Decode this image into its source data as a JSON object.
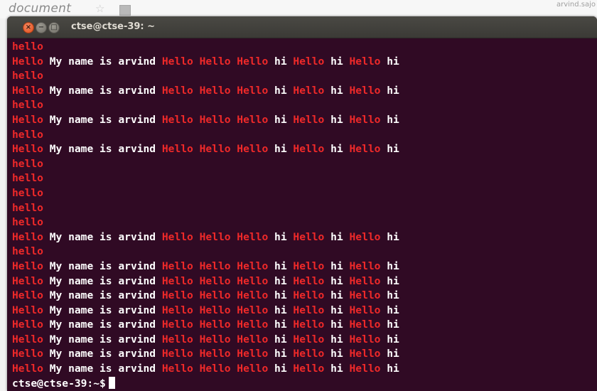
{
  "background": {
    "doc_title": "document",
    "user_text": "arvind.sajo"
  },
  "window": {
    "title": "ctse@ctse-39: ~",
    "buttons": {
      "close": "×",
      "minimize": "−",
      "maximize": "□"
    }
  },
  "colors": {
    "background": "#300a24",
    "red": "#ef2929",
    "text": "#ffffff"
  },
  "terminal": {
    "lines": [
      [
        [
          "red",
          "hello"
        ]
      ],
      [
        [
          "red",
          "Hello"
        ],
        [
          "white",
          " My name is arvind "
        ],
        [
          "red",
          "Hello Hello Hello"
        ],
        [
          "white",
          " hi "
        ],
        [
          "red",
          "Hello"
        ],
        [
          "white",
          " hi "
        ],
        [
          "red",
          "Hello"
        ],
        [
          "white",
          " hi"
        ]
      ],
      [
        [
          "red",
          "hello"
        ]
      ],
      [
        [
          "red",
          "Hello"
        ],
        [
          "white",
          " My name is arvind "
        ],
        [
          "red",
          "Hello Hello Hello"
        ],
        [
          "white",
          " hi "
        ],
        [
          "red",
          "Hello"
        ],
        [
          "white",
          " hi "
        ],
        [
          "red",
          "Hello"
        ],
        [
          "white",
          " hi"
        ]
      ],
      [
        [
          "red",
          "hello"
        ]
      ],
      [
        [
          "red",
          "Hello"
        ],
        [
          "white",
          " My name is arvind "
        ],
        [
          "red",
          "Hello Hello Hello"
        ],
        [
          "white",
          " hi "
        ],
        [
          "red",
          "Hello"
        ],
        [
          "white",
          " hi "
        ],
        [
          "red",
          "Hello"
        ],
        [
          "white",
          " hi"
        ]
      ],
      [
        [
          "red",
          "hello"
        ]
      ],
      [
        [
          "red",
          "Hello"
        ],
        [
          "white",
          " My name is arvind "
        ],
        [
          "red",
          "Hello Hello Hello"
        ],
        [
          "white",
          " hi "
        ],
        [
          "red",
          "Hello"
        ],
        [
          "white",
          " hi "
        ],
        [
          "red",
          "Hello"
        ],
        [
          "white",
          " hi"
        ]
      ],
      [
        [
          "red",
          "hello"
        ]
      ],
      [
        [
          "red",
          "hello"
        ]
      ],
      [
        [
          "red",
          "hello"
        ]
      ],
      [
        [
          "red",
          "hello"
        ]
      ],
      [
        [
          "red",
          "hello"
        ]
      ],
      [
        [
          "red",
          "Hello"
        ],
        [
          "white",
          " My name is arvind "
        ],
        [
          "red",
          "Hello Hello Hello"
        ],
        [
          "white",
          " hi "
        ],
        [
          "red",
          "Hello"
        ],
        [
          "white",
          " hi "
        ],
        [
          "red",
          "Hello"
        ],
        [
          "white",
          " hi"
        ]
      ],
      [
        [
          "red",
          "hello"
        ]
      ],
      [
        [
          "red",
          "Hello"
        ],
        [
          "white",
          " My name is arvind "
        ],
        [
          "red",
          "Hello Hello Hello"
        ],
        [
          "white",
          " hi "
        ],
        [
          "red",
          "Hello"
        ],
        [
          "white",
          " hi "
        ],
        [
          "red",
          "Hello"
        ],
        [
          "white",
          " hi"
        ]
      ],
      [
        [
          "red",
          "Hello"
        ],
        [
          "white",
          " My name is arvind "
        ],
        [
          "red",
          "Hello Hello Hello"
        ],
        [
          "white",
          " hi "
        ],
        [
          "red",
          "Hello"
        ],
        [
          "white",
          " hi "
        ],
        [
          "red",
          "Hello"
        ],
        [
          "white",
          " hi"
        ]
      ],
      [
        [
          "red",
          "Hello"
        ],
        [
          "white",
          " My name is arvind "
        ],
        [
          "red",
          "Hello Hello Hello"
        ],
        [
          "white",
          " hi "
        ],
        [
          "red",
          "Hello"
        ],
        [
          "white",
          " hi "
        ],
        [
          "red",
          "Hello"
        ],
        [
          "white",
          " hi"
        ]
      ],
      [
        [
          "red",
          "Hello"
        ],
        [
          "white",
          " My name is arvind "
        ],
        [
          "red",
          "Hello Hello Hello"
        ],
        [
          "white",
          " hi "
        ],
        [
          "red",
          "Hello"
        ],
        [
          "white",
          " hi "
        ],
        [
          "red",
          "Hello"
        ],
        [
          "white",
          " hi"
        ]
      ],
      [
        [
          "red",
          "Hello"
        ],
        [
          "white",
          " My name is arvind "
        ],
        [
          "red",
          "Hello Hello Hello"
        ],
        [
          "white",
          " hi "
        ],
        [
          "red",
          "Hello"
        ],
        [
          "white",
          " hi "
        ],
        [
          "red",
          "Hello"
        ],
        [
          "white",
          " hi"
        ]
      ],
      [
        [
          "red",
          "Hello"
        ],
        [
          "white",
          " My name is arvind "
        ],
        [
          "red",
          "Hello Hello Hello"
        ],
        [
          "white",
          " hi "
        ],
        [
          "red",
          "Hello"
        ],
        [
          "white",
          " hi "
        ],
        [
          "red",
          "Hello"
        ],
        [
          "white",
          " hi"
        ]
      ],
      [
        [
          "red",
          "Hello"
        ],
        [
          "white",
          " My name is arvind "
        ],
        [
          "red",
          "Hello Hello Hello"
        ],
        [
          "white",
          " hi "
        ],
        [
          "red",
          "Hello"
        ],
        [
          "white",
          " hi "
        ],
        [
          "red",
          "Hello"
        ],
        [
          "white",
          " hi"
        ]
      ],
      [
        [
          "red",
          "Hello"
        ],
        [
          "white",
          " My name is arvind "
        ],
        [
          "red",
          "Hello Hello Hello"
        ],
        [
          "white",
          " hi "
        ],
        [
          "red",
          "Hello"
        ],
        [
          "white",
          " hi "
        ],
        [
          "red",
          "Hello"
        ],
        [
          "white",
          " hi"
        ]
      ]
    ],
    "prompt": "ctse@ctse-39:~$"
  }
}
